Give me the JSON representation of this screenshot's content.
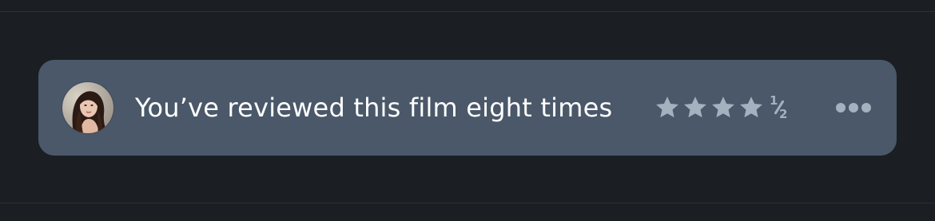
{
  "review_bar": {
    "message": "You’ve reviewed this film eight times",
    "avatar_icon": "user-avatar-photo",
    "rating": {
      "value": 4.5,
      "max": 5,
      "full_stars": 4,
      "half_label_num": "1",
      "half_label_den": "2",
      "star_icon": "star-icon"
    },
    "more_icon": "more-horizontal-icon"
  },
  "colors": {
    "page_background": "#1b1e23",
    "bar_background": "#4a5869",
    "text": "#ffffff",
    "rating": "#a4b2c0"
  }
}
